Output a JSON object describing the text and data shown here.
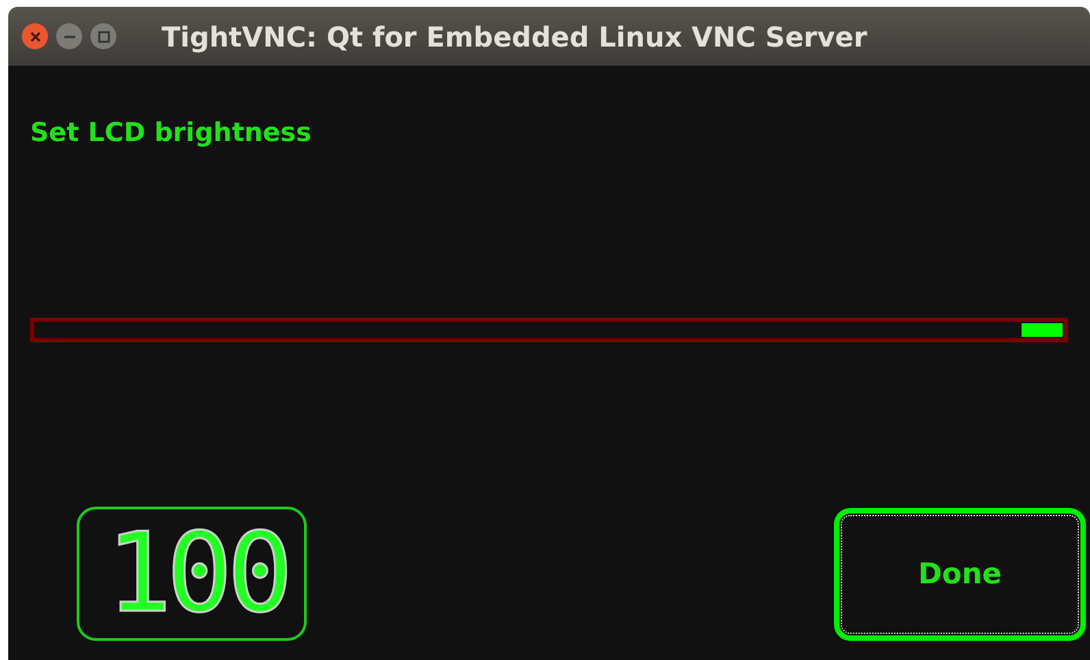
{
  "window": {
    "title": "TightVNC: Qt for Embedded Linux VNC Server"
  },
  "heading": "Set LCD brightness",
  "slider": {
    "level": 1
  },
  "display": {
    "value": "100"
  },
  "buttons": [
    {
      "label": "Done",
      "focused": true
    }
  ]
}
